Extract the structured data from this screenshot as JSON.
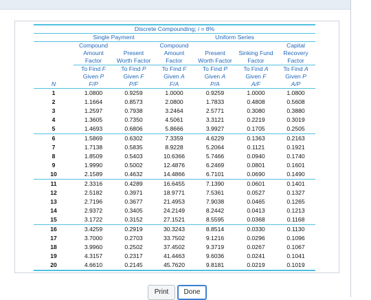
{
  "table": {
    "title_prefix": "Discrete Compounding; ",
    "title_var": "i",
    "title_suffix": " = 8%",
    "groups": {
      "single": "Single Payment",
      "uniform": "Uniform Series"
    },
    "factor_names": [
      [
        "Compound",
        "Amount",
        "Factor"
      ],
      [
        "Present",
        "Worth Factor"
      ],
      [
        "Compound",
        "Amount",
        "Factor"
      ],
      [
        "Present",
        "Worth Factor"
      ],
      [
        "Sinking Fund",
        "Factor"
      ],
      [
        "Capital",
        "Recovery",
        "Factor"
      ]
    ],
    "find_lines": [
      [
        "To Find ",
        "F",
        "Given ",
        "P",
        "F/P"
      ],
      [
        "To Find ",
        "P",
        "Given ",
        "F",
        "P/F"
      ],
      [
        "To Find ",
        "F",
        "Given ",
        "A",
        "F/A"
      ],
      [
        "To Find ",
        "P",
        "Given ",
        "A",
        "P/A"
      ],
      [
        "To Find ",
        "A",
        "Given ",
        "F",
        "A/F"
      ],
      [
        "To Find ",
        "A",
        "Given ",
        "P",
        "A/P"
      ]
    ],
    "n_label": "N",
    "rows": [
      [
        "1",
        "1.0800",
        "0.9259",
        "1.0000",
        "0.9259",
        "1.0000",
        "1.0800"
      ],
      [
        "2",
        "1.1664",
        "0.8573",
        "2.0800",
        "1.7833",
        "0.4808",
        "0.5608"
      ],
      [
        "3",
        "1.2597",
        "0.7938",
        "3.2464",
        "2.5771",
        "0.3080",
        "0.3880"
      ],
      [
        "4",
        "1.3605",
        "0.7350",
        "4.5061",
        "3.3121",
        "0.2219",
        "0.3019"
      ],
      [
        "5",
        "1.4693",
        "0.6806",
        "5.8666",
        "3.9927",
        "0.1705",
        "0.2505"
      ],
      [
        "6",
        "1.5869",
        "0.6302",
        "7.3359",
        "4.6229",
        "0.1363",
        "0.2163"
      ],
      [
        "7",
        "1.7138",
        "0.5835",
        "8.9228",
        "5.2064",
        "0.1121",
        "0.1921"
      ],
      [
        "8",
        "1.8509",
        "0.5403",
        "10.6366",
        "5.7466",
        "0.0940",
        "0.1740"
      ],
      [
        "9",
        "1.9990",
        "0.5002",
        "12.4876",
        "6.2469",
        "0.0801",
        "0.1601"
      ],
      [
        "10",
        "2.1589",
        "0.4632",
        "14.4866",
        "6.7101",
        "0.0690",
        "0.1490"
      ],
      [
        "11",
        "2.3316",
        "0.4289",
        "16.6455",
        "7.1390",
        "0.0601",
        "0.1401"
      ],
      [
        "12",
        "2.5182",
        "0.3971",
        "18.9771",
        "7.5361",
        "0.0527",
        "0.1327"
      ],
      [
        "13",
        "2.7196",
        "0.3677",
        "21.4953",
        "7.9038",
        "0.0465",
        "0.1265"
      ],
      [
        "14",
        "2.9372",
        "0.3405",
        "24.2149",
        "8.2442",
        "0.0413",
        "0.1213"
      ],
      [
        "15",
        "3.1722",
        "0.3152",
        "27.1521",
        "8.5595",
        "0.0368",
        "0.1168"
      ],
      [
        "16",
        "3.4259",
        "0.2919",
        "30.3243",
        "8.8514",
        "0.0330",
        "0.1130"
      ],
      [
        "17",
        "3.7000",
        "0.2703",
        "33.7502",
        "9.1216",
        "0.0296",
        "0.1096"
      ],
      [
        "18",
        "3.9960",
        "0.2502",
        "37.4502",
        "9.3719",
        "0.0267",
        "0.1067"
      ],
      [
        "19",
        "4.3157",
        "0.2317",
        "41.4463",
        "9.6036",
        "0.0241",
        "0.1041"
      ],
      [
        "20",
        "4.6610",
        "0.2145",
        "45.7620",
        "9.8181",
        "0.0219",
        "0.1019"
      ]
    ]
  },
  "buttons": {
    "print": "Print",
    "done": "Done"
  }
}
